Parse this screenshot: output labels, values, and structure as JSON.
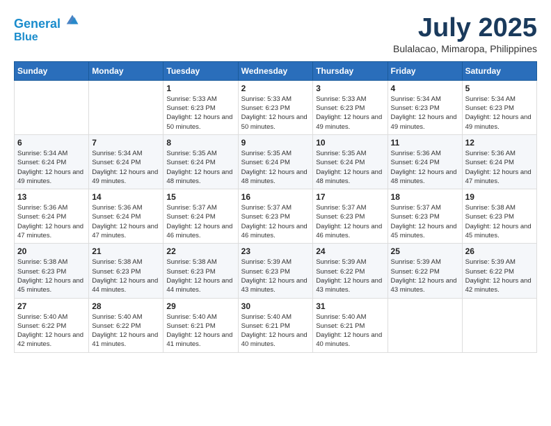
{
  "logo": {
    "line1": "General",
    "line2": "Blue"
  },
  "title": "July 2025",
  "location": "Bulalacao, Mimaropa, Philippines",
  "days_of_week": [
    "Sunday",
    "Monday",
    "Tuesday",
    "Wednesday",
    "Thursday",
    "Friday",
    "Saturday"
  ],
  "weeks": [
    [
      {
        "day": "",
        "info": ""
      },
      {
        "day": "",
        "info": ""
      },
      {
        "day": "1",
        "info": "Sunrise: 5:33 AM\nSunset: 6:23 PM\nDaylight: 12 hours and 50 minutes."
      },
      {
        "day": "2",
        "info": "Sunrise: 5:33 AM\nSunset: 6:23 PM\nDaylight: 12 hours and 50 minutes."
      },
      {
        "day": "3",
        "info": "Sunrise: 5:33 AM\nSunset: 6:23 PM\nDaylight: 12 hours and 49 minutes."
      },
      {
        "day": "4",
        "info": "Sunrise: 5:34 AM\nSunset: 6:23 PM\nDaylight: 12 hours and 49 minutes."
      },
      {
        "day": "5",
        "info": "Sunrise: 5:34 AM\nSunset: 6:23 PM\nDaylight: 12 hours and 49 minutes."
      }
    ],
    [
      {
        "day": "6",
        "info": "Sunrise: 5:34 AM\nSunset: 6:24 PM\nDaylight: 12 hours and 49 minutes."
      },
      {
        "day": "7",
        "info": "Sunrise: 5:34 AM\nSunset: 6:24 PM\nDaylight: 12 hours and 49 minutes."
      },
      {
        "day": "8",
        "info": "Sunrise: 5:35 AM\nSunset: 6:24 PM\nDaylight: 12 hours and 48 minutes."
      },
      {
        "day": "9",
        "info": "Sunrise: 5:35 AM\nSunset: 6:24 PM\nDaylight: 12 hours and 48 minutes."
      },
      {
        "day": "10",
        "info": "Sunrise: 5:35 AM\nSunset: 6:24 PM\nDaylight: 12 hours and 48 minutes."
      },
      {
        "day": "11",
        "info": "Sunrise: 5:36 AM\nSunset: 6:24 PM\nDaylight: 12 hours and 48 minutes."
      },
      {
        "day": "12",
        "info": "Sunrise: 5:36 AM\nSunset: 6:24 PM\nDaylight: 12 hours and 47 minutes."
      }
    ],
    [
      {
        "day": "13",
        "info": "Sunrise: 5:36 AM\nSunset: 6:24 PM\nDaylight: 12 hours and 47 minutes."
      },
      {
        "day": "14",
        "info": "Sunrise: 5:36 AM\nSunset: 6:24 PM\nDaylight: 12 hours and 47 minutes."
      },
      {
        "day": "15",
        "info": "Sunrise: 5:37 AM\nSunset: 6:24 PM\nDaylight: 12 hours and 46 minutes."
      },
      {
        "day": "16",
        "info": "Sunrise: 5:37 AM\nSunset: 6:23 PM\nDaylight: 12 hours and 46 minutes."
      },
      {
        "day": "17",
        "info": "Sunrise: 5:37 AM\nSunset: 6:23 PM\nDaylight: 12 hours and 46 minutes."
      },
      {
        "day": "18",
        "info": "Sunrise: 5:37 AM\nSunset: 6:23 PM\nDaylight: 12 hours and 45 minutes."
      },
      {
        "day": "19",
        "info": "Sunrise: 5:38 AM\nSunset: 6:23 PM\nDaylight: 12 hours and 45 minutes."
      }
    ],
    [
      {
        "day": "20",
        "info": "Sunrise: 5:38 AM\nSunset: 6:23 PM\nDaylight: 12 hours and 45 minutes."
      },
      {
        "day": "21",
        "info": "Sunrise: 5:38 AM\nSunset: 6:23 PM\nDaylight: 12 hours and 44 minutes."
      },
      {
        "day": "22",
        "info": "Sunrise: 5:38 AM\nSunset: 6:23 PM\nDaylight: 12 hours and 44 minutes."
      },
      {
        "day": "23",
        "info": "Sunrise: 5:39 AM\nSunset: 6:23 PM\nDaylight: 12 hours and 43 minutes."
      },
      {
        "day": "24",
        "info": "Sunrise: 5:39 AM\nSunset: 6:22 PM\nDaylight: 12 hours and 43 minutes."
      },
      {
        "day": "25",
        "info": "Sunrise: 5:39 AM\nSunset: 6:22 PM\nDaylight: 12 hours and 43 minutes."
      },
      {
        "day": "26",
        "info": "Sunrise: 5:39 AM\nSunset: 6:22 PM\nDaylight: 12 hours and 42 minutes."
      }
    ],
    [
      {
        "day": "27",
        "info": "Sunrise: 5:40 AM\nSunset: 6:22 PM\nDaylight: 12 hours and 42 minutes."
      },
      {
        "day": "28",
        "info": "Sunrise: 5:40 AM\nSunset: 6:22 PM\nDaylight: 12 hours and 41 minutes."
      },
      {
        "day": "29",
        "info": "Sunrise: 5:40 AM\nSunset: 6:21 PM\nDaylight: 12 hours and 41 minutes."
      },
      {
        "day": "30",
        "info": "Sunrise: 5:40 AM\nSunset: 6:21 PM\nDaylight: 12 hours and 40 minutes."
      },
      {
        "day": "31",
        "info": "Sunrise: 5:40 AM\nSunset: 6:21 PM\nDaylight: 12 hours and 40 minutes."
      },
      {
        "day": "",
        "info": ""
      },
      {
        "day": "",
        "info": ""
      }
    ]
  ]
}
